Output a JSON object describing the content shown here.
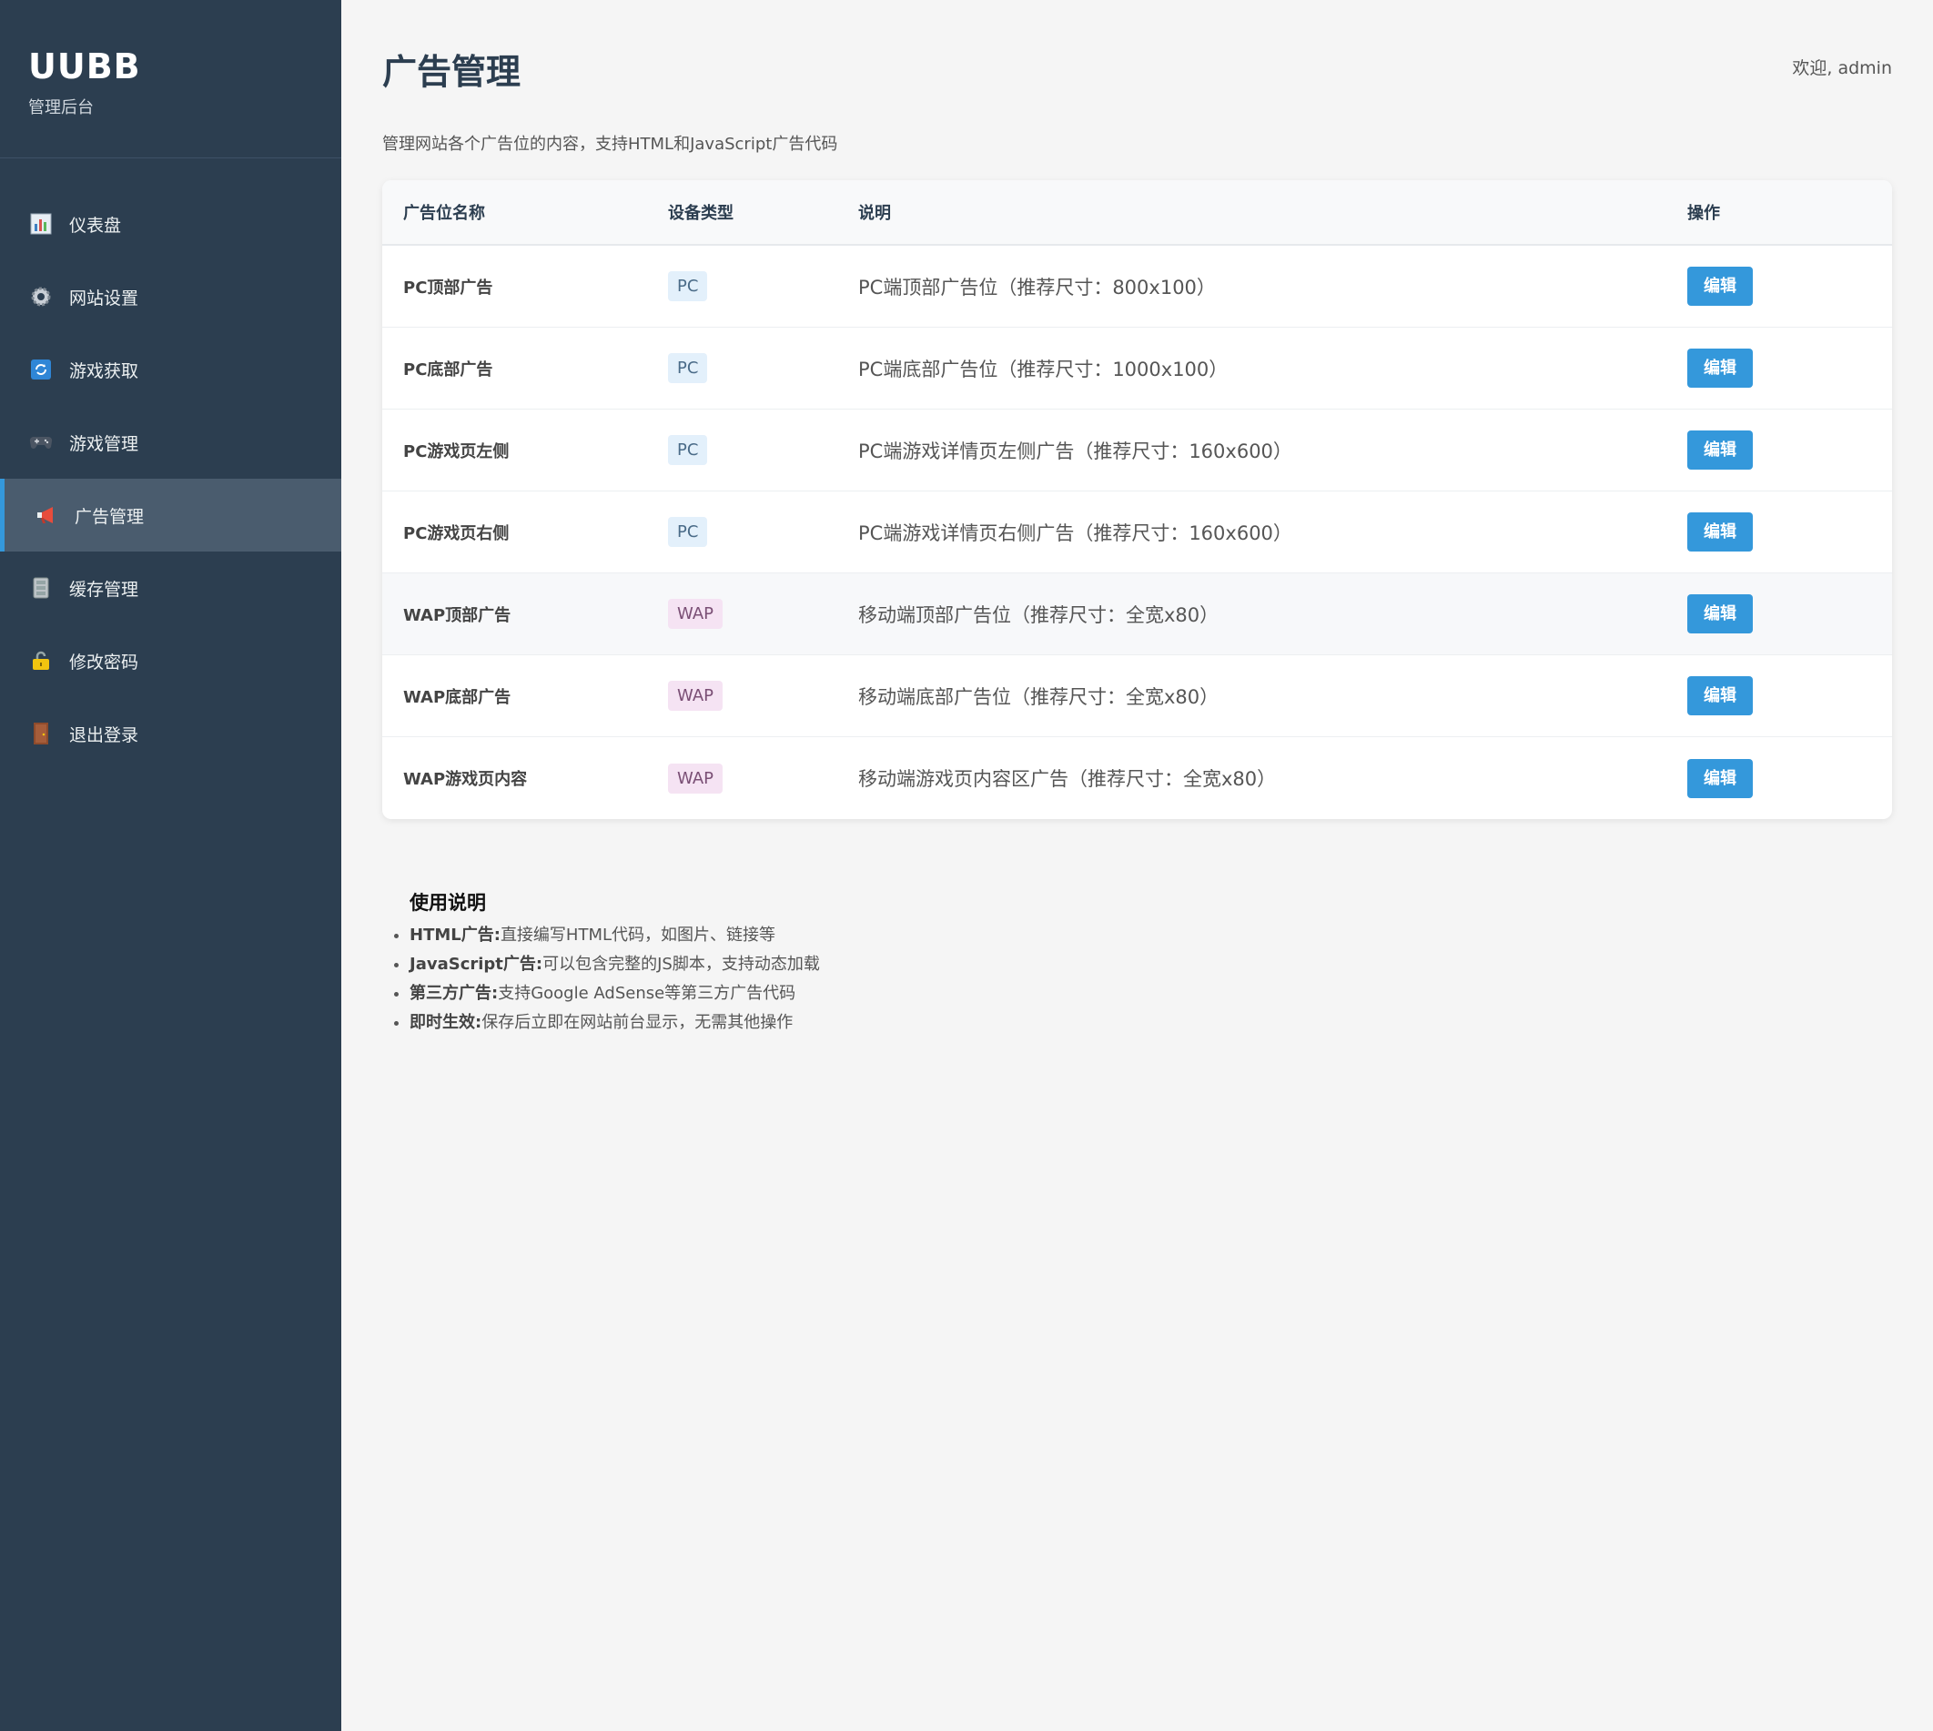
{
  "sidebar": {
    "brand_title": "UUBB",
    "brand_sub": "管理后台",
    "items": [
      {
        "label": "仪表盘",
        "icon": "chart-icon"
      },
      {
        "label": "网站设置",
        "icon": "gear-icon"
      },
      {
        "label": "游戏获取",
        "icon": "refresh-icon"
      },
      {
        "label": "游戏管理",
        "icon": "gamepad-icon"
      },
      {
        "label": "广告管理",
        "icon": "megaphone-icon",
        "active": true
      },
      {
        "label": "缓存管理",
        "icon": "cabinet-icon"
      },
      {
        "label": "修改密码",
        "icon": "lock-icon"
      },
      {
        "label": "退出登录",
        "icon": "door-icon"
      }
    ]
  },
  "header": {
    "title": "广告管理",
    "welcome": "欢迎, admin",
    "description": "管理网站各个广告位的内容，支持HTML和JavaScript广告代码"
  },
  "table": {
    "headers": [
      "广告位名称",
      "设备类型",
      "说明",
      "操作"
    ],
    "rows": [
      {
        "name": "PC顶部广告",
        "type": "PC",
        "desc": "PC端顶部广告位（推荐尺寸：800x100）",
        "action": "编辑"
      },
      {
        "name": "PC底部广告",
        "type": "PC",
        "desc": "PC端底部广告位（推荐尺寸：1000x100）",
        "action": "编辑"
      },
      {
        "name": "PC游戏页左侧",
        "type": "PC",
        "desc": "PC端游戏详情页左侧广告（推荐尺寸：160x600）",
        "action": "编辑"
      },
      {
        "name": "PC游戏页右侧",
        "type": "PC",
        "desc": "PC端游戏详情页右侧广告（推荐尺寸：160x600）",
        "action": "编辑"
      },
      {
        "name": "WAP顶部广告",
        "type": "WAP",
        "desc": "移动端顶部广告位（推荐尺寸：全宽x80）",
        "action": "编辑"
      },
      {
        "name": "WAP底部广告",
        "type": "WAP",
        "desc": "移动端底部广告位（推荐尺寸：全宽x80）",
        "action": "编辑"
      },
      {
        "name": "WAP游戏页内容",
        "type": "WAP",
        "desc": "移动端游戏页内容区广告（推荐尺寸：全宽x80）",
        "action": "编辑"
      }
    ]
  },
  "notes": {
    "title": "使用说明",
    "items": [
      {
        "label": "HTML广告:",
        "text": "直接编写HTML代码，如图片、链接等"
      },
      {
        "label": "JavaScript广告:",
        "text": "可以包含完整的JS脚本，支持动态加载"
      },
      {
        "label": "第三方广告:",
        "text": "支持Google AdSense等第三方广告代码"
      },
      {
        "label": "即时生效:",
        "text": "保存后立即在网站前台显示，无需其他操作"
      }
    ]
  },
  "colors": {
    "sidebar_bg": "#2c3e50",
    "accent": "#3498db",
    "page_bg": "#f5f5f5"
  }
}
